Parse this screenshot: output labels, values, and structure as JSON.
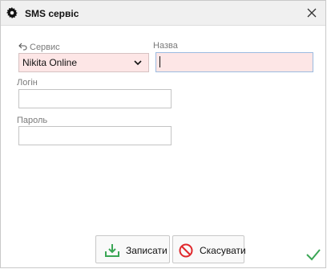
{
  "dialog": {
    "title": "SMS сервіс",
    "icons": {
      "title": "gear-icon",
      "close": "close-icon"
    }
  },
  "form": {
    "service": {
      "label": "Сервис",
      "value": "Nikita Online",
      "icon": "back-arrow-icon"
    },
    "name": {
      "label": "Назва",
      "value": ""
    },
    "login": {
      "label": "Логін",
      "value": ""
    },
    "password": {
      "label": "Пароль",
      "value": ""
    }
  },
  "actions": {
    "save_label": "Записати",
    "cancel_label": "Скасувати"
  },
  "colors": {
    "required_bg": "#fde6e6",
    "save_icon": "#3aa655",
    "cancel_icon": "#e0282c",
    "check": "#3aa655"
  }
}
